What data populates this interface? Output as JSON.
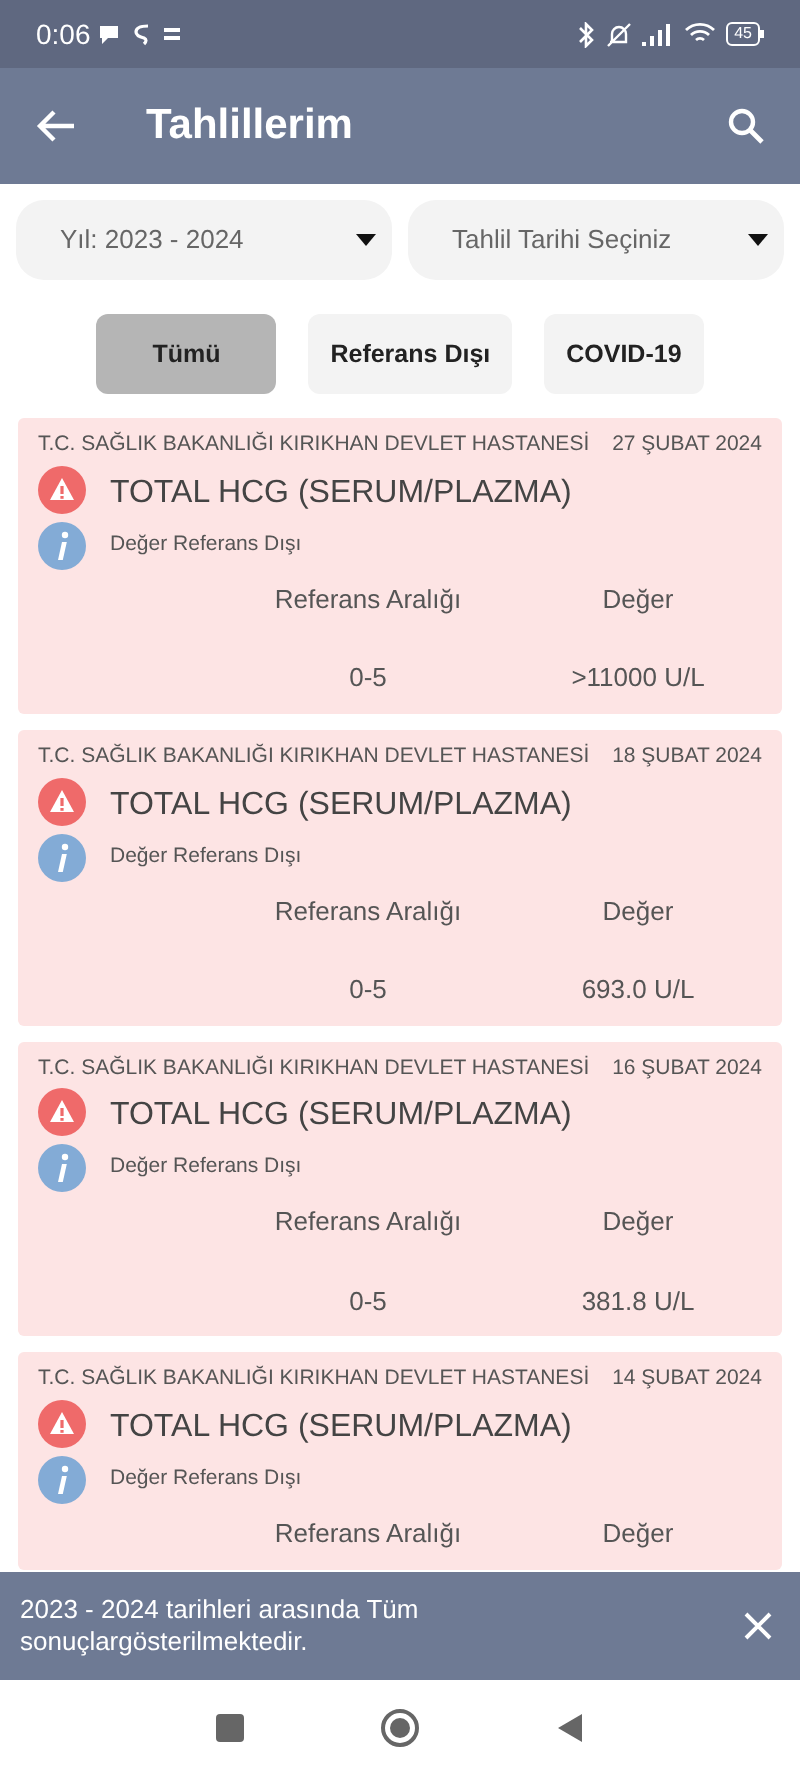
{
  "status_bar": {
    "time": "0:06",
    "battery": "45"
  },
  "app_bar": {
    "title": "Tahlillerim"
  },
  "filters": [
    {
      "label": "Yıl: 2023 - 2024"
    },
    {
      "label": "Tahlil Tarihi Seçiniz"
    }
  ],
  "chips": [
    {
      "label": "Tümü",
      "selected": true
    },
    {
      "label": "Referans Dışı",
      "selected": false
    },
    {
      "label": "COVID-19",
      "selected": false
    }
  ],
  "results": [
    {
      "hospital": "T.C. SAĞLIK BAKANLIĞI KIRIKHAN DEVLET HASTANESİ",
      "date": "27 ŞUBAT 2024",
      "test": "TOTAL HCG (SERUM/PLAZMA)",
      "note": "Değer Referans Dışı",
      "range_label": "Referans Aralığı",
      "value_label": "Değer",
      "range": "0-5",
      "value": ">11000 U/L"
    },
    {
      "hospital": "T.C. SAĞLIK BAKANLIĞI KIRIKHAN DEVLET HASTANESİ",
      "date": "18 ŞUBAT 2024",
      "test": "TOTAL HCG (SERUM/PLAZMA)",
      "note": "Değer Referans Dışı",
      "range_label": "Referans Aralığı",
      "value_label": "Değer",
      "range": "0-5",
      "value": "693.0 U/L"
    },
    {
      "hospital": "T.C. SAĞLIK BAKANLIĞI KIRIKHAN DEVLET HASTANESİ",
      "date": "16 ŞUBAT 2024",
      "test": "TOTAL HCG (SERUM/PLAZMA)",
      "note": "Değer Referans Dışı",
      "range_label": "Referans Aralığı",
      "value_label": "Değer",
      "range": "0-5",
      "value": "381.8 U/L"
    },
    {
      "hospital": "T.C. SAĞLIK BAKANLIĞI KIRIKHAN DEVLET HASTANESİ",
      "date": "14 ŞUBAT 2024",
      "test": "TOTAL HCG (SERUM/PLAZMA)",
      "note": "Değer Referans Dışı",
      "range_label": "Referans Aralığı",
      "value_label": "Değer"
    }
  ],
  "snackbar": {
    "message": "2023 - 2024 tarihleri arasında Tüm sonuçlargösterilmektedir."
  }
}
